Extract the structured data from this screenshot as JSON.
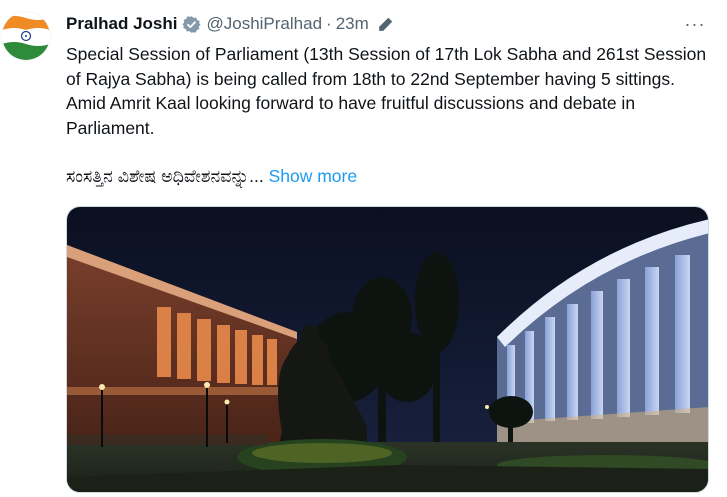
{
  "author": {
    "display_name": "Pralhad Joshi",
    "handle": "@JoshiPralhad",
    "separator": "·",
    "time": "23m",
    "verified_icon": "verified-badge-icon",
    "edit_icon": "pencil-edit-icon"
  },
  "menu": {
    "more_label": "···"
  },
  "tweet": {
    "text": "Special Session of Parliament (13th Session of 17th Lok Sabha and 261st Session of Rajya Sabha) is being called from 18th to 22nd September having 5 sittings.  Amid Amrit Kaal looking forward to have fruitful discussions and debate in Parliament.",
    "kannada_text": "ಸಂಸತ್ತಿನ ವಿಶೇಷ ಅಧಿವೇಶನವನ್ನು...",
    "show_more": "Show more"
  },
  "colors": {
    "link": "#1d9bf0",
    "secondary_text": "#536471",
    "verified": "#1d9bf0"
  }
}
